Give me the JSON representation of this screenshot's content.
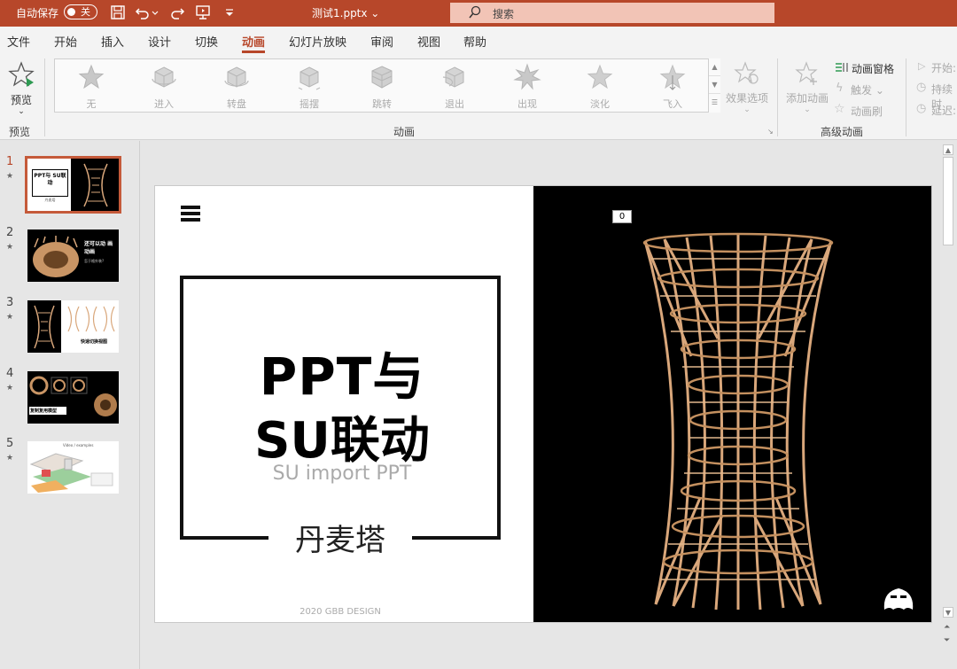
{
  "titlebar": {
    "autosave_label": "自动保存",
    "autosave_state": "关",
    "doc_title": "测试1.pptx ⌄",
    "search_placeholder": "搜索"
  },
  "tabs": [
    "文件",
    "开始",
    "插入",
    "设计",
    "切换",
    "动画",
    "幻灯片放映",
    "审阅",
    "视图",
    "帮助"
  ],
  "active_tab": "动画",
  "ribbon": {
    "preview_label": "预览",
    "preview_group": "预览",
    "animations_group": "动画",
    "advanced_group": "高级动画",
    "animations": [
      "无",
      "进入",
      "转盘",
      "摇摆",
      "跳转",
      "退出",
      "出现",
      "淡化",
      "飞入"
    ],
    "effect_options": "效果选项",
    "add_animation": "添加动画",
    "animation_pane": "动画窗格",
    "trigger": "触发 ⌄",
    "animation_painter": "动画刷",
    "start": "开始:",
    "duration": "持续时",
    "delay": "延迟:"
  },
  "slides": [
    {
      "num": "1",
      "star": "★"
    },
    {
      "num": "2",
      "star": "★"
    },
    {
      "num": "3",
      "star": "★"
    },
    {
      "num": "4",
      "star": "★"
    },
    {
      "num": "5",
      "star": "★"
    }
  ],
  "thumb_text": {
    "t1_title": "PPT与 SU联动",
    "t1_author": "丹麦塔",
    "t2_text": "还可以动 画动画",
    "t2_sub": "怎于格外装?",
    "t3_text": "快速切换视图",
    "t4_text": "复制复用模型",
    "t5_text": "Video / examples"
  },
  "current_slide": {
    "title_line1": "PPT与",
    "title_line2": "SU联动",
    "subtitle": "SU import PPT",
    "author": "丹麦塔",
    "credit": "2020 GBB DESIGN",
    "anim_tag": "0"
  },
  "colors": {
    "accent": "#b7472a",
    "slide_bg_left": "#ffffff",
    "slide_bg_right": "#000000",
    "wood": "#d9a77b"
  }
}
